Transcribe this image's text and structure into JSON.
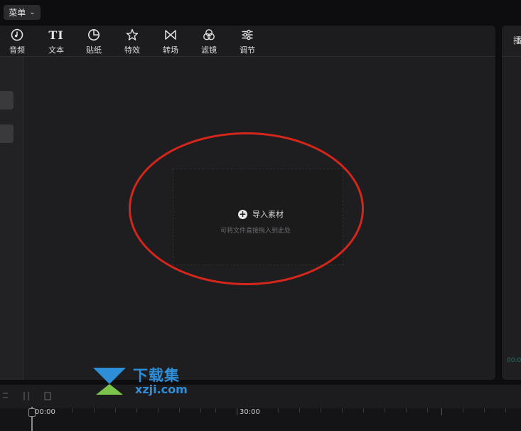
{
  "menu": {
    "label": "菜单",
    "chevron": "⌄"
  },
  "toolbar": {
    "items": [
      {
        "label": "音频",
        "icon": "music-disc-icon"
      },
      {
        "label": "文本",
        "icon": "text-icon",
        "glyph": "TI"
      },
      {
        "label": "贴纸",
        "icon": "sticker-icon"
      },
      {
        "label": "特效",
        "icon": "effects-star-icon"
      },
      {
        "label": "转场",
        "icon": "transition-icon"
      },
      {
        "label": "滤镜",
        "icon": "filter-icon"
      },
      {
        "label": "调节",
        "icon": "adjust-sliders-icon"
      }
    ]
  },
  "media": {
    "import_label": "导入素材",
    "import_plus": "+",
    "hint": "可将文件直接拖入到此处"
  },
  "right_panel": {
    "title": "播",
    "time": "00:0"
  },
  "timeline": {
    "time_start": "00:00",
    "time_mid": "30:00"
  },
  "watermark": {
    "title": "下载集",
    "domain": "xzji.com"
  },
  "colors": {
    "highlight_oval": "#d5261c",
    "watermark_blue": "#2f8ed8",
    "watermark_green": "#7bc34a"
  }
}
